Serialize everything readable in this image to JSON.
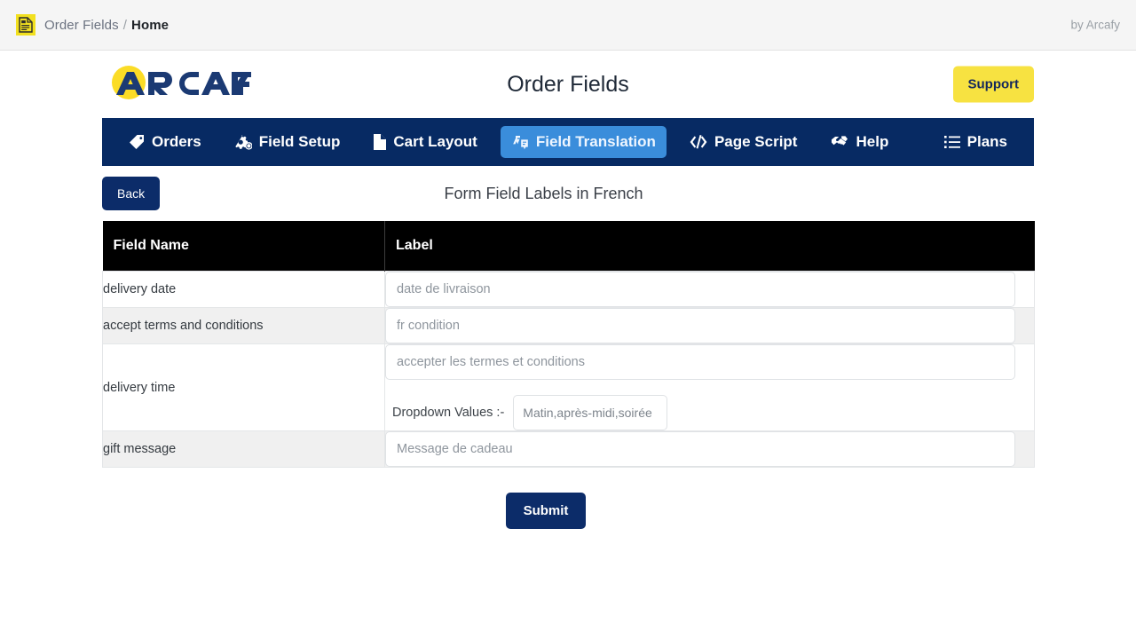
{
  "topbar": {
    "app_icon": "order-document-icon",
    "breadcrumb_root": "Order Fields",
    "breadcrumb_sep": "/",
    "breadcrumb_current": "Home",
    "byline": "by Arcafy"
  },
  "header": {
    "logo_text": "ARCAFY",
    "title": "Order Fields",
    "support_label": "Support",
    "brand_navy": "#1b3a73",
    "brand_yellow": "#f7e241"
  },
  "nav": {
    "background": "#072a63",
    "active_background": "#3a8ddb",
    "items": [
      {
        "label": "Orders",
        "icon": "tag-icon",
        "active": false
      },
      {
        "label": "Field Setup",
        "icon": "cogs-icon",
        "active": false
      },
      {
        "label": "Cart Layout",
        "icon": "file-icon",
        "active": false
      },
      {
        "label": "Field Translation",
        "icon": "language-icon",
        "active": true
      },
      {
        "label": "Page Script",
        "icon": "code-icon",
        "active": false
      },
      {
        "label": "Help",
        "icon": "handshake-icon",
        "active": false
      }
    ],
    "right_item": {
      "label": "Plans",
      "icon": "list-icon"
    }
  },
  "subhead": {
    "back_label": "Back",
    "title": "Form Field Labels in French"
  },
  "table": {
    "columns": [
      "Field Name",
      "Label"
    ],
    "rows": [
      {
        "field_name": "delivery date",
        "label_value": "date de livraison",
        "has_dropdown": false
      },
      {
        "field_name": "accept terms and conditions",
        "label_value": "fr condition",
        "has_dropdown": false
      },
      {
        "field_name": "delivery time",
        "label_value": "accepter les termes et conditions",
        "has_dropdown": true,
        "dropdown_label": "Dropdown Values :-",
        "dropdown_value": "Matin,après-midi,soirée"
      },
      {
        "field_name": "gift message",
        "label_value": "Message de cadeau",
        "has_dropdown": false
      }
    ]
  },
  "footer": {
    "submit_label": "Submit"
  }
}
